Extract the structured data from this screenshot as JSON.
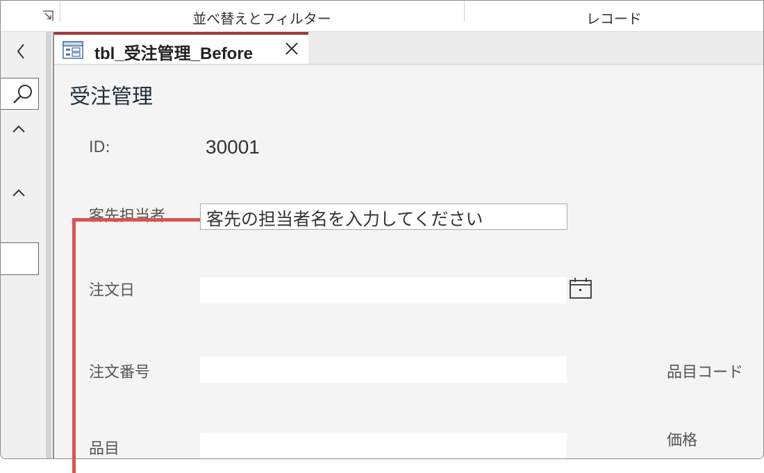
{
  "ribbon": {
    "groups": [
      "並べ替えとフィルター",
      "レコード"
    ]
  },
  "tab": {
    "title": "tbl_受注管理_Before",
    "close_glyph": "✕"
  },
  "form": {
    "title": "受注管理",
    "fields": {
      "id": {
        "label": "ID:",
        "value": "30001"
      },
      "contact": {
        "label": "客先担当者",
        "value": "客先の担当者名を入力してください"
      },
      "order_date": {
        "label": "注文日",
        "value": ""
      },
      "order_no": {
        "label": "注文番号",
        "value": ""
      },
      "item_code": {
        "label": "品目コード"
      },
      "item": {
        "label": "品目",
        "value": ""
      },
      "price": {
        "label": "価格"
      }
    }
  },
  "icons": {
    "back": "chevron-left-icon",
    "search": "search-icon",
    "collapse": "chevron-up-icon",
    "calendar": "calendar-icon",
    "launcher": "dialog-launcher-icon",
    "form": "form-icon"
  },
  "colors": {
    "accent": "#a4373a",
    "callout": "#d9534f"
  }
}
